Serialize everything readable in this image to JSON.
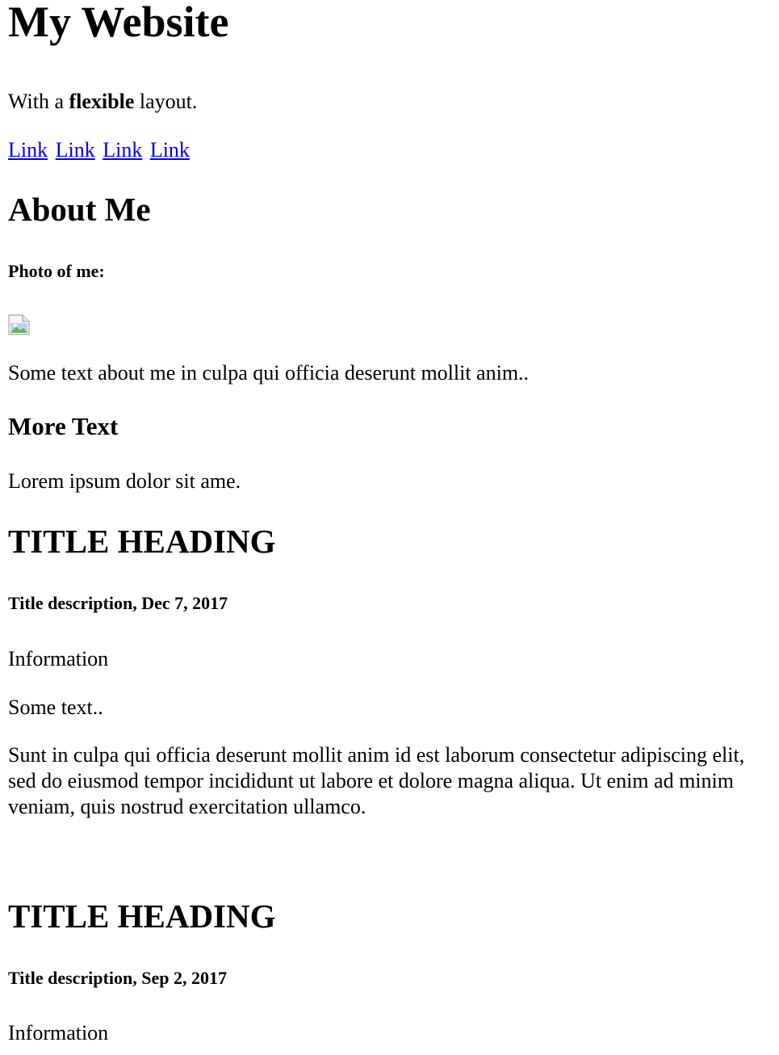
{
  "header": {
    "site_title": "My Website",
    "tagline_prefix": "With a ",
    "tagline_bold": "flexible",
    "tagline_suffix": " layout."
  },
  "nav": {
    "links": [
      "Link",
      "Link",
      "Link",
      "Link"
    ]
  },
  "about": {
    "heading": "About Me",
    "photo_label": "Photo of me:",
    "photo_icon": "broken-image-icon",
    "text": "Some text about me in culpa qui officia deserunt mollit anim..",
    "more_heading": "More Text",
    "more_text": "Lorem ipsum dolor sit ame."
  },
  "posts": [
    {
      "title": "TITLE HEADING",
      "description": "Title description, Dec 7, 2017",
      "info": "Information",
      "text": "Some text..",
      "body": "Sunt in culpa qui officia deserunt mollit anim id est laborum consectetur adipiscing elit, sed do eiusmod tempor incididunt ut labore et dolore magna aliqua. Ut enim ad minim veniam, quis nostrud exercitation ullamco."
    },
    {
      "title": "TITLE HEADING",
      "description": "Title description, Sep 2, 2017",
      "info": "Information"
    }
  ],
  "colors": {
    "link": "#0000ee",
    "text": "#000000",
    "background": "#ffffff"
  }
}
